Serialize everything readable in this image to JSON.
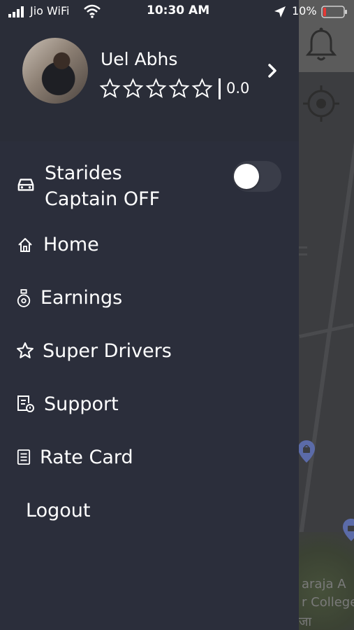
{
  "status_bar": {
    "carrier": "Jio WiFi",
    "time": "10:30 AM",
    "battery": "10%"
  },
  "profile": {
    "name": "Uel Abhs",
    "stars_filled": 0,
    "stars_total": 5,
    "rating": "0.0"
  },
  "captain_toggle": {
    "label_line1": "Starides",
    "label_line2": "Captain OFF",
    "state": "off"
  },
  "menu": {
    "home": "Home",
    "earnings": "Earnings",
    "super_drivers": "Super Drivers",
    "support": "Support",
    "rate_card": "Rate Card",
    "logout": "Logout"
  },
  "map": {
    "labels": [
      "araja A",
      "r College",
      "जा"
    ]
  },
  "colors": {
    "drawer_bg": "#2b2e3b",
    "header_bg": "#2a2d38",
    "text": "#ffffff",
    "map_bg": "#3c3d40",
    "battery_low": "#e53935"
  }
}
